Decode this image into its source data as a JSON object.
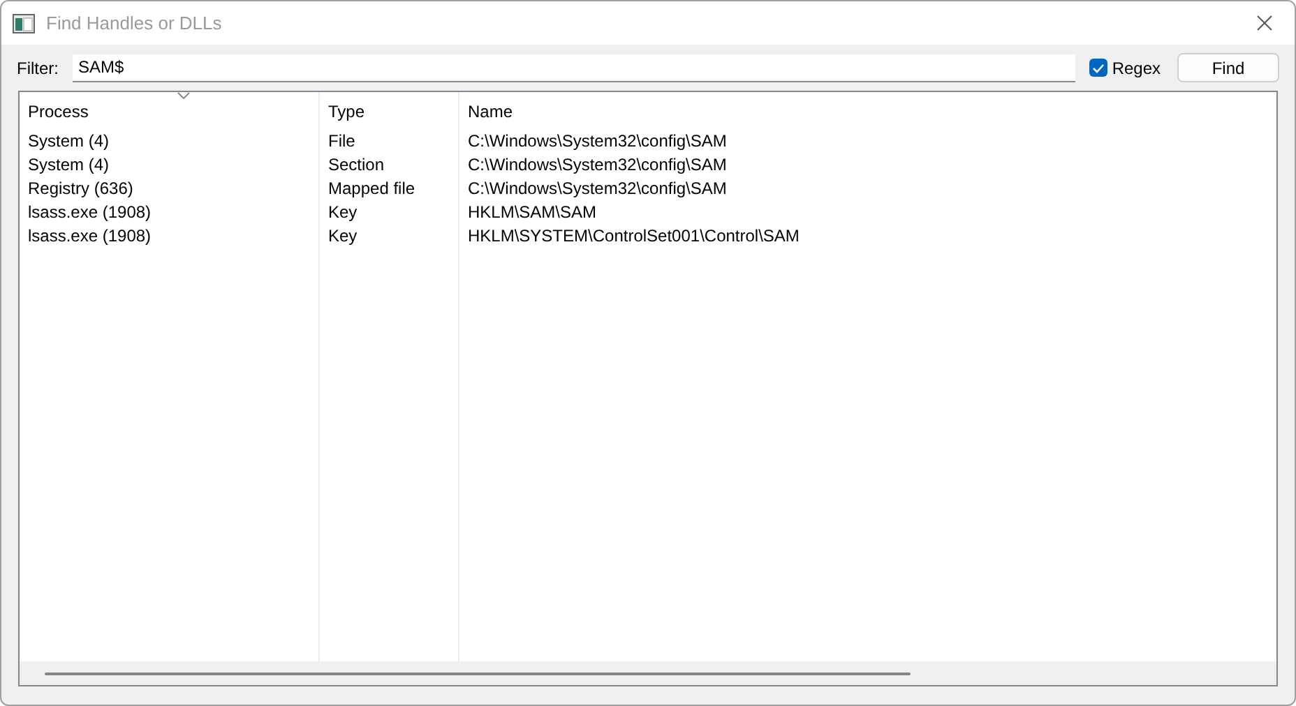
{
  "window": {
    "title": "Find Handles or DLLs"
  },
  "filter": {
    "label": "Filter:",
    "value": "SAM$"
  },
  "regex": {
    "label": "Regex",
    "checked": true
  },
  "find_button": "Find",
  "table": {
    "columns": [
      {
        "label": "Process",
        "sorted": true
      },
      {
        "label": "Type",
        "sorted": false
      },
      {
        "label": "Name",
        "sorted": false
      }
    ],
    "rows": [
      [
        "System (4)",
        "File",
        "C:\\Windows\\System32\\config\\SAM"
      ],
      [
        "System (4)",
        "Section",
        "C:\\Windows\\System32\\config\\SAM"
      ],
      [
        "Registry (636)",
        "Mapped file",
        "C:\\Windows\\System32\\config\\SAM"
      ],
      [
        "lsass.exe (1908)",
        "Key",
        "HKLM\\SAM\\SAM"
      ],
      [
        "lsass.exe (1908)",
        "Key",
        "HKLM\\SYSTEM\\ControlSet001\\Control\\SAM"
      ]
    ]
  }
}
